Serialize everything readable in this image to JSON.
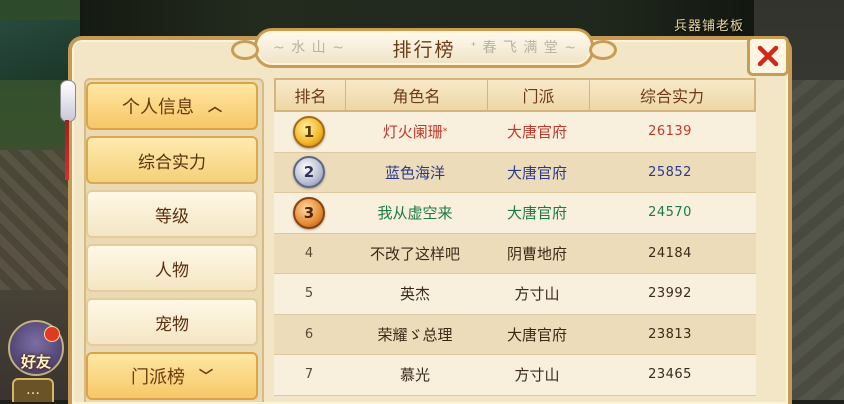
{
  "background": {
    "shop_sign": "兵器铺老板"
  },
  "hud": {
    "friend_label": "好友",
    "chat_label": "…"
  },
  "window": {
    "title": "排行榜",
    "title_deco_left": "~ 水 山 ~",
    "title_deco_right": "ᐩ 春 飞 满 堂 ~"
  },
  "sidebar": {
    "personal_category": "个人信息",
    "items": [
      {
        "label": "综合实力",
        "active": true
      },
      {
        "label": "等级"
      },
      {
        "label": "人物"
      },
      {
        "label": "宠物"
      }
    ],
    "sect_category": "门派榜"
  },
  "table": {
    "headers": [
      "排名",
      "角色名",
      "门派",
      "综合实力"
    ],
    "rows": [
      {
        "rank": "1",
        "name": "灯火阑珊",
        "name_mark": "*",
        "sect": "大唐官府",
        "power": "26139",
        "color": "#c0392b"
      },
      {
        "rank": "2",
        "name": "蓝色海洋",
        "sect": "大唐官府",
        "power": "25852",
        "color": "#2b3a8c"
      },
      {
        "rank": "3",
        "name": "我从虚空来",
        "sect": "大唐官府",
        "power": "24570",
        "color": "#1c7a4a"
      },
      {
        "rank": "4",
        "name": "不改了这样吧",
        "sect": "阴曹地府",
        "power": "24184",
        "color": "#3a2a1a"
      },
      {
        "rank": "5",
        "name": "英杰",
        "sect": "方寸山",
        "power": "23992",
        "color": "#3a2a1a"
      },
      {
        "rank": "6",
        "name": "荣耀ゞ总理",
        "sect": "大唐官府",
        "power": "23813",
        "color": "#3a2a1a"
      },
      {
        "rank": "7",
        "name": "慕光",
        "sect": "方寸山",
        "power": "23465",
        "color": "#3a2a1a"
      }
    ]
  },
  "colors": {
    "accent": "#c59a55",
    "panel": "#f3e6c6",
    "close": "#d0281b"
  }
}
